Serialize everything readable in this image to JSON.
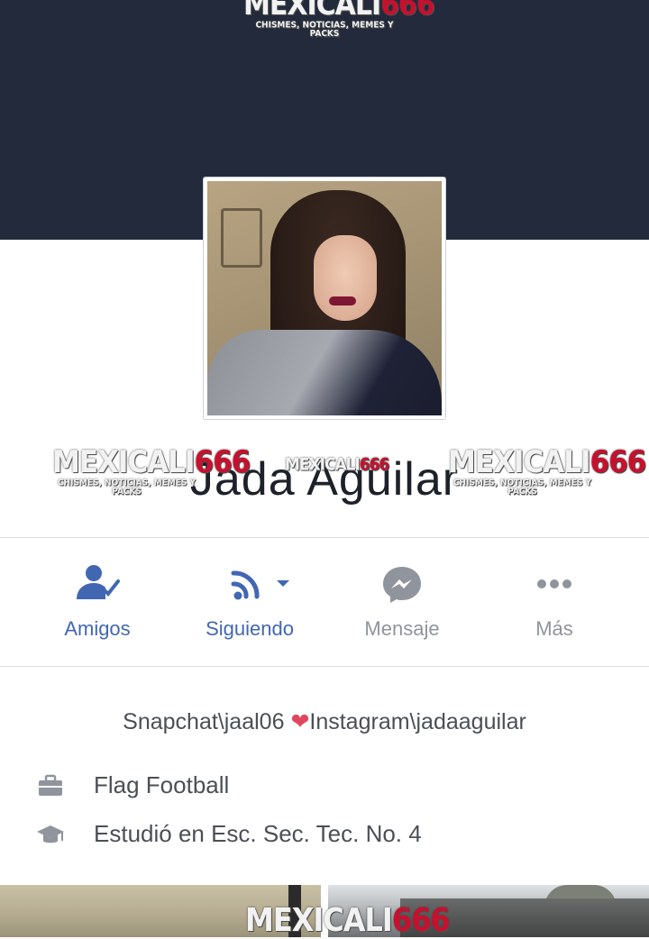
{
  "watermark": {
    "brand_white": "MEXICALI",
    "brand_red": "666",
    "tagline_top": "CHISMES, NOTICIAS, MEMES Y PACKS",
    "tagline": "CHISMES, NOTICIAS, MEMES Y PACKS"
  },
  "profile": {
    "name": "Jada Aguilar"
  },
  "actions": [
    {
      "label": "Amigos",
      "icon": "friends-check-icon",
      "color": "#4267b2"
    },
    {
      "label": "Siguiendo",
      "icon": "rss-follow-icon",
      "color": "#4267b2"
    },
    {
      "label": "Mensaje",
      "icon": "messenger-icon",
      "color": "#90949c"
    },
    {
      "label": "Más",
      "icon": "more-dots-icon",
      "color": "#90949c"
    }
  ],
  "intro": {
    "bio_part1": "Snapchat\\jaal06 ",
    "bio_heart": "❤",
    "bio_part2": "Instagram\\jadaaguilar",
    "work": "Flag Football",
    "education": "Estudió en Esc. Sec. Tec. No. 4"
  },
  "colors": {
    "cover": "#222a3b",
    "accent": "#4267b2",
    "muted": "#90949c",
    "text": "#4b4f56"
  }
}
